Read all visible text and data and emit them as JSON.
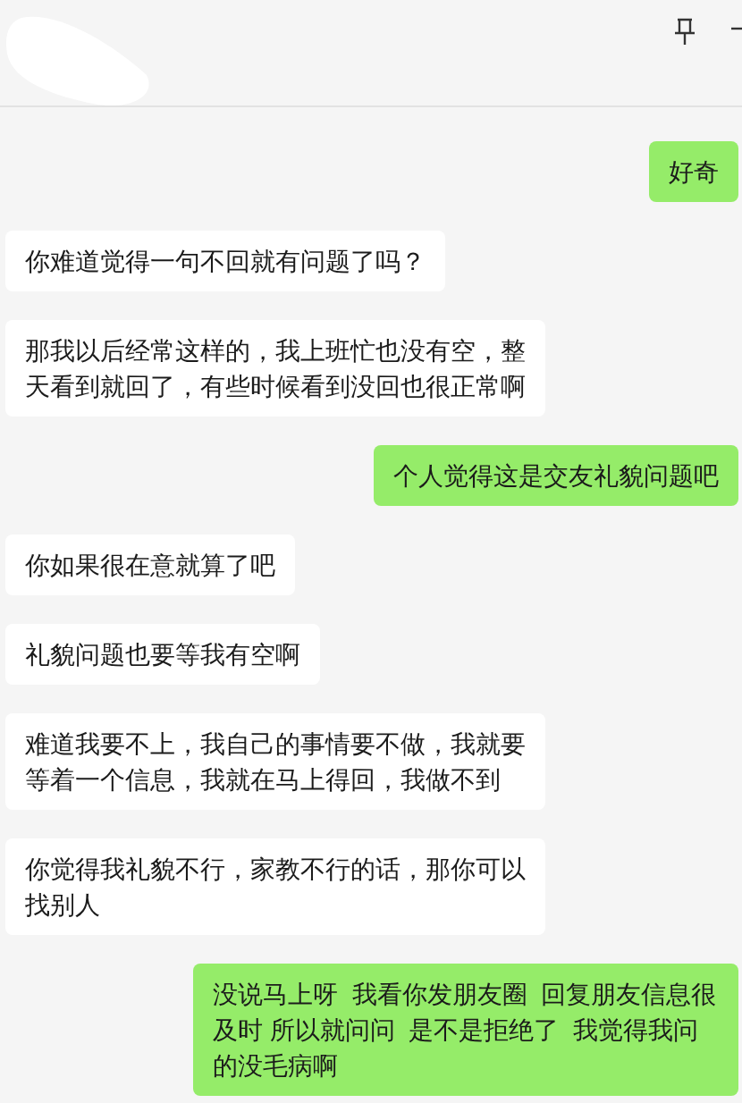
{
  "messages": [
    {
      "kind": "outgoing",
      "text": "好奇"
    },
    {
      "kind": "incoming",
      "text": "你难道觉得一句不回就有问题了吗？"
    },
    {
      "kind": "incoming",
      "text": "那我以后经常这样的，我上班忙也没有空，整天看到就回了，有些时候看到没回也很正常啊"
    },
    {
      "kind": "outgoing",
      "text": "个人觉得这是交友礼貌问题吧"
    },
    {
      "kind": "incoming",
      "text": "你如果很在意就算了吧"
    },
    {
      "kind": "incoming",
      "text": "礼貌问题也要等我有空啊"
    },
    {
      "kind": "incoming",
      "text": "难道我要不上，我自己的事情要不做，我就要等着一个信息，我就在马上得回，我做不到"
    },
    {
      "kind": "incoming",
      "text": "你觉得我礼貌不行，家教不行的话，那你可以找别人"
    },
    {
      "kind": "outgoing",
      "text": "没说马上呀  我看你发朋友圈  回复朋友信息很及时 所以就问问  是不是拒绝了  我觉得我问的没毛病啊"
    }
  ]
}
